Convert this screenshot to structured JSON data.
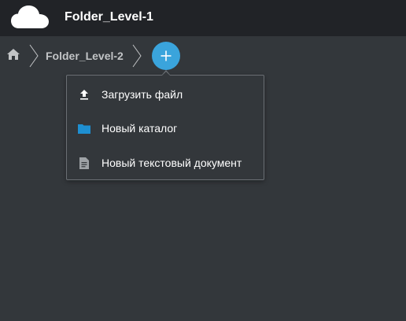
{
  "header": {
    "title": "Folder_Level-1",
    "logo_icon": "cloud-icon"
  },
  "breadcrumb": {
    "home_icon": "home-icon",
    "items": [
      {
        "label": "Folder_Level-2"
      }
    ]
  },
  "add_button": {
    "icon": "plus-icon",
    "color": "#3aa4dc"
  },
  "new_menu": {
    "items": [
      {
        "label": "Загрузить файл",
        "icon": "upload-icon"
      },
      {
        "label": "Новый каталог",
        "icon": "folder-icon",
        "icon_color": "#1e8fd1"
      },
      {
        "label": "Новый текстовый документ",
        "icon": "text-document-icon"
      }
    ]
  }
}
